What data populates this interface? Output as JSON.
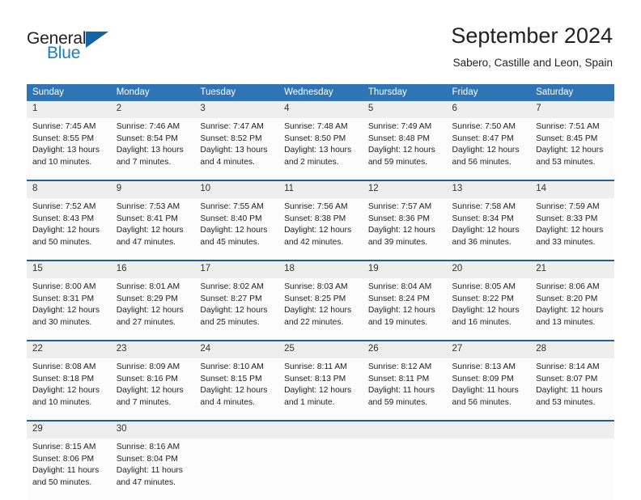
{
  "brand": {
    "name_part1": "General",
    "name_part2": "Blue",
    "triangle_icon": "triangle-logo-icon",
    "blue": "#1a7dc4",
    "dark_blue": "#1464a5"
  },
  "header": {
    "month_title": "September 2024",
    "location": "Sabero, Castille and Leon, Spain"
  },
  "theme": {
    "header_blue": "#2f75b5",
    "separator_blue": "#1f5fa0",
    "daynum_band": "#eeeeee"
  },
  "weekdays": [
    "Sunday",
    "Monday",
    "Tuesday",
    "Wednesday",
    "Thursday",
    "Friday",
    "Saturday"
  ],
  "weeks": [
    {
      "days": [
        {
          "num": "1",
          "sunrise": "Sunrise: 7:45 AM",
          "sunset": "Sunset: 8:55 PM",
          "daylight1": "Daylight: 13 hours",
          "daylight2": "and 10 minutes."
        },
        {
          "num": "2",
          "sunrise": "Sunrise: 7:46 AM",
          "sunset": "Sunset: 8:54 PM",
          "daylight1": "Daylight: 13 hours",
          "daylight2": "and 7 minutes."
        },
        {
          "num": "3",
          "sunrise": "Sunrise: 7:47 AM",
          "sunset": "Sunset: 8:52 PM",
          "daylight1": "Daylight: 13 hours",
          "daylight2": "and 4 minutes."
        },
        {
          "num": "4",
          "sunrise": "Sunrise: 7:48 AM",
          "sunset": "Sunset: 8:50 PM",
          "daylight1": "Daylight: 13 hours",
          "daylight2": "and 2 minutes."
        },
        {
          "num": "5",
          "sunrise": "Sunrise: 7:49 AM",
          "sunset": "Sunset: 8:48 PM",
          "daylight1": "Daylight: 12 hours",
          "daylight2": "and 59 minutes."
        },
        {
          "num": "6",
          "sunrise": "Sunrise: 7:50 AM",
          "sunset": "Sunset: 8:47 PM",
          "daylight1": "Daylight: 12 hours",
          "daylight2": "and 56 minutes."
        },
        {
          "num": "7",
          "sunrise": "Sunrise: 7:51 AM",
          "sunset": "Sunset: 8:45 PM",
          "daylight1": "Daylight: 12 hours",
          "daylight2": "and 53 minutes."
        }
      ]
    },
    {
      "days": [
        {
          "num": "8",
          "sunrise": "Sunrise: 7:52 AM",
          "sunset": "Sunset: 8:43 PM",
          "daylight1": "Daylight: 12 hours",
          "daylight2": "and 50 minutes."
        },
        {
          "num": "9",
          "sunrise": "Sunrise: 7:53 AM",
          "sunset": "Sunset: 8:41 PM",
          "daylight1": "Daylight: 12 hours",
          "daylight2": "and 47 minutes."
        },
        {
          "num": "10",
          "sunrise": "Sunrise: 7:55 AM",
          "sunset": "Sunset: 8:40 PM",
          "daylight1": "Daylight: 12 hours",
          "daylight2": "and 45 minutes."
        },
        {
          "num": "11",
          "sunrise": "Sunrise: 7:56 AM",
          "sunset": "Sunset: 8:38 PM",
          "daylight1": "Daylight: 12 hours",
          "daylight2": "and 42 minutes."
        },
        {
          "num": "12",
          "sunrise": "Sunrise: 7:57 AM",
          "sunset": "Sunset: 8:36 PM",
          "daylight1": "Daylight: 12 hours",
          "daylight2": "and 39 minutes."
        },
        {
          "num": "13",
          "sunrise": "Sunrise: 7:58 AM",
          "sunset": "Sunset: 8:34 PM",
          "daylight1": "Daylight: 12 hours",
          "daylight2": "and 36 minutes."
        },
        {
          "num": "14",
          "sunrise": "Sunrise: 7:59 AM",
          "sunset": "Sunset: 8:33 PM",
          "daylight1": "Daylight: 12 hours",
          "daylight2": "and 33 minutes."
        }
      ]
    },
    {
      "days": [
        {
          "num": "15",
          "sunrise": "Sunrise: 8:00 AM",
          "sunset": "Sunset: 8:31 PM",
          "daylight1": "Daylight: 12 hours",
          "daylight2": "and 30 minutes."
        },
        {
          "num": "16",
          "sunrise": "Sunrise: 8:01 AM",
          "sunset": "Sunset: 8:29 PM",
          "daylight1": "Daylight: 12 hours",
          "daylight2": "and 27 minutes."
        },
        {
          "num": "17",
          "sunrise": "Sunrise: 8:02 AM",
          "sunset": "Sunset: 8:27 PM",
          "daylight1": "Daylight: 12 hours",
          "daylight2": "and 25 minutes."
        },
        {
          "num": "18",
          "sunrise": "Sunrise: 8:03 AM",
          "sunset": "Sunset: 8:25 PM",
          "daylight1": "Daylight: 12 hours",
          "daylight2": "and 22 minutes."
        },
        {
          "num": "19",
          "sunrise": "Sunrise: 8:04 AM",
          "sunset": "Sunset: 8:24 PM",
          "daylight1": "Daylight: 12 hours",
          "daylight2": "and 19 minutes."
        },
        {
          "num": "20",
          "sunrise": "Sunrise: 8:05 AM",
          "sunset": "Sunset: 8:22 PM",
          "daylight1": "Daylight: 12 hours",
          "daylight2": "and 16 minutes."
        },
        {
          "num": "21",
          "sunrise": "Sunrise: 8:06 AM",
          "sunset": "Sunset: 8:20 PM",
          "daylight1": "Daylight: 12 hours",
          "daylight2": "and 13 minutes."
        }
      ]
    },
    {
      "days": [
        {
          "num": "22",
          "sunrise": "Sunrise: 8:08 AM",
          "sunset": "Sunset: 8:18 PM",
          "daylight1": "Daylight: 12 hours",
          "daylight2": "and 10 minutes."
        },
        {
          "num": "23",
          "sunrise": "Sunrise: 8:09 AM",
          "sunset": "Sunset: 8:16 PM",
          "daylight1": "Daylight: 12 hours",
          "daylight2": "and 7 minutes."
        },
        {
          "num": "24",
          "sunrise": "Sunrise: 8:10 AM",
          "sunset": "Sunset: 8:15 PM",
          "daylight1": "Daylight: 12 hours",
          "daylight2": "and 4 minutes."
        },
        {
          "num": "25",
          "sunrise": "Sunrise: 8:11 AM",
          "sunset": "Sunset: 8:13 PM",
          "daylight1": "Daylight: 12 hours",
          "daylight2": "and 1 minute."
        },
        {
          "num": "26",
          "sunrise": "Sunrise: 8:12 AM",
          "sunset": "Sunset: 8:11 PM",
          "daylight1": "Daylight: 11 hours",
          "daylight2": "and 59 minutes."
        },
        {
          "num": "27",
          "sunrise": "Sunrise: 8:13 AM",
          "sunset": "Sunset: 8:09 PM",
          "daylight1": "Daylight: 11 hours",
          "daylight2": "and 56 minutes."
        },
        {
          "num": "28",
          "sunrise": "Sunrise: 8:14 AM",
          "sunset": "Sunset: 8:07 PM",
          "daylight1": "Daylight: 11 hours",
          "daylight2": "and 53 minutes."
        }
      ]
    },
    {
      "days": [
        {
          "num": "29",
          "sunrise": "Sunrise: 8:15 AM",
          "sunset": "Sunset: 8:06 PM",
          "daylight1": "Daylight: 11 hours",
          "daylight2": "and 50 minutes."
        },
        {
          "num": "30",
          "sunrise": "Sunrise: 8:16 AM",
          "sunset": "Sunset: 8:04 PM",
          "daylight1": "Daylight: 11 hours",
          "daylight2": "and 47 minutes."
        },
        {
          "num": "",
          "sunrise": "",
          "sunset": "",
          "daylight1": "",
          "daylight2": ""
        },
        {
          "num": "",
          "sunrise": "",
          "sunset": "",
          "daylight1": "",
          "daylight2": ""
        },
        {
          "num": "",
          "sunrise": "",
          "sunset": "",
          "daylight1": "",
          "daylight2": ""
        },
        {
          "num": "",
          "sunrise": "",
          "sunset": "",
          "daylight1": "",
          "daylight2": ""
        },
        {
          "num": "",
          "sunrise": "",
          "sunset": "",
          "daylight1": "",
          "daylight2": ""
        }
      ]
    }
  ]
}
